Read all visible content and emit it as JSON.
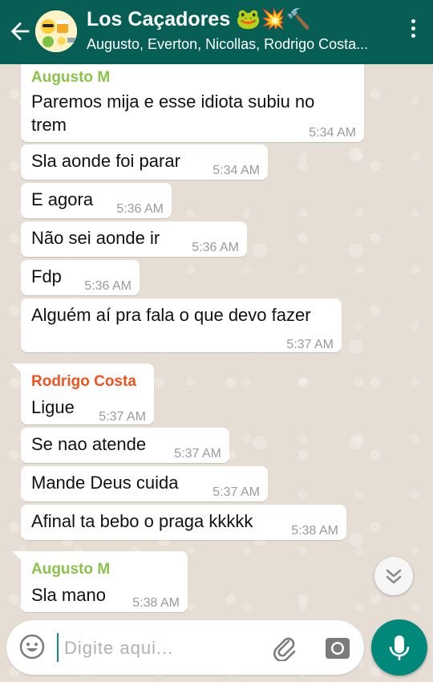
{
  "header": {
    "title": "Los Caçadores 🐸💥🔨",
    "subtitle": "Augusto, Everton, Nicollas, Rodrigo Costa..."
  },
  "colors": {
    "header_bg": "#075e54",
    "sender_green": "#8bc34a",
    "sender_orange": "#f4511e",
    "accent": "#00897b"
  },
  "messages": [
    {
      "sender": "Augusto M",
      "text_line1": "Paremos mija e esse idiota subiu no",
      "text_line2": "trem",
      "time": "5:34 AM"
    },
    {
      "text": "Sla aonde foi parar",
      "time": "5:34 AM"
    },
    {
      "text": "E agora",
      "time": "5:36 AM"
    },
    {
      "text": "Não sei aonde ir",
      "time": "5:36 AM"
    },
    {
      "text": "Fdp",
      "time": "5:36 AM"
    },
    {
      "text": "Alguém aí pra fala o que devo fazer",
      "time": "5:37 AM"
    },
    {
      "sender": "Rodrigo Costa",
      "text": "Ligue",
      "time": "5:37 AM"
    },
    {
      "text": "Se nao atende",
      "time": "5:37 AM"
    },
    {
      "text": "Mande Deus cuida",
      "time": "5:37 AM"
    },
    {
      "text": "Afinal ta bebo o praga kkkkk",
      "time": "5:38 AM"
    },
    {
      "sender": "Augusto M",
      "text": "Sla mano",
      "time": "5:38 AM"
    }
  ],
  "composer": {
    "placeholder": "Digite aqui...",
    "icons": [
      "emoji-icon",
      "paperclip-icon",
      "camera-icon",
      "microphone-icon"
    ]
  }
}
